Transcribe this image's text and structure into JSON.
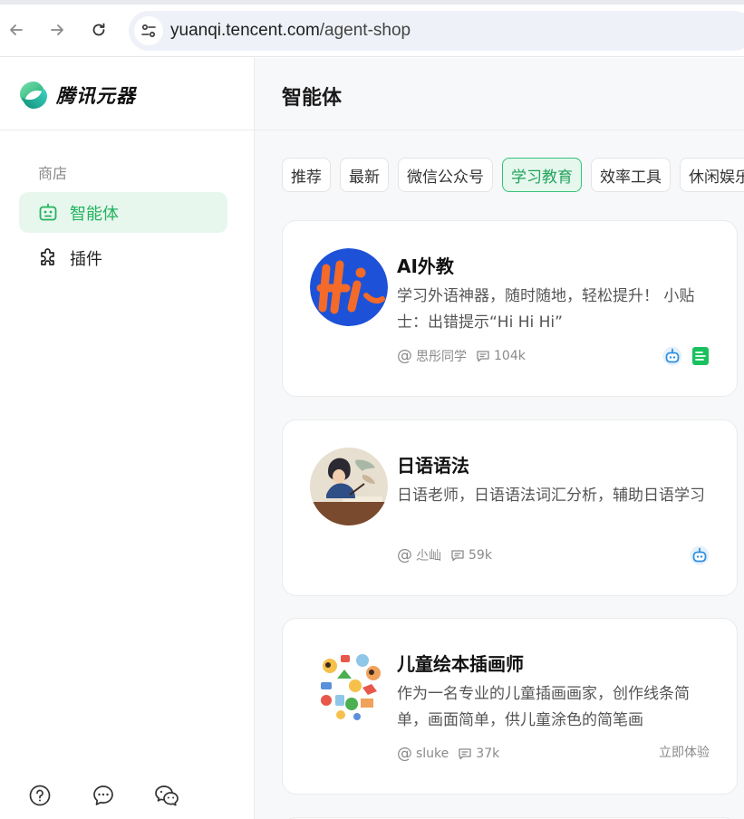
{
  "browser": {
    "url_host": "yuanqi.tencent.com",
    "url_path": "/agent-shop"
  },
  "sidebar": {
    "brand": "腾讯元器",
    "section_label": "商店",
    "items": [
      {
        "label": "智能体",
        "icon": "robot-icon",
        "active": true
      },
      {
        "label": "插件",
        "icon": "puzzle-icon",
        "active": false
      }
    ],
    "footer_icons": [
      "help-icon",
      "feedback-icon",
      "wechat-icon"
    ]
  },
  "main": {
    "title": "智能体",
    "tabs": [
      {
        "label": "推荐",
        "active": false
      },
      {
        "label": "最新",
        "active": false
      },
      {
        "label": "微信公众号",
        "active": false
      },
      {
        "label": "学习教育",
        "active": true
      },
      {
        "label": "效率工具",
        "active": false
      },
      {
        "label": "休闲娱乐",
        "active": false
      }
    ],
    "cards": [
      {
        "title": "AI外教",
        "description": "学习外语神器，随时随地，轻松提升！ 小贴士：出错提示“Hi Hi Hi”",
        "author": "思彤同学",
        "count": "104k",
        "badges": [
          "robot-badge-icon",
          "document-badge-icon"
        ]
      },
      {
        "title": "日语语法",
        "description": "日语老师，日语语法词汇分析，辅助日语学习",
        "author": "尐屾",
        "count": "59k",
        "badges": [
          "robot-badge-icon"
        ]
      },
      {
        "title": "儿童绘本插画师",
        "description": "作为一名专业的儿童插画画家，创作线条简单，画面简单，供儿童涂色的简笔画",
        "author": "sluke",
        "count": "37k",
        "action": "立即体验"
      }
    ]
  },
  "colors": {
    "accent": "#22b35e",
    "accent_bg": "#e8f7ee",
    "page_bg": "#f7f8fa"
  }
}
